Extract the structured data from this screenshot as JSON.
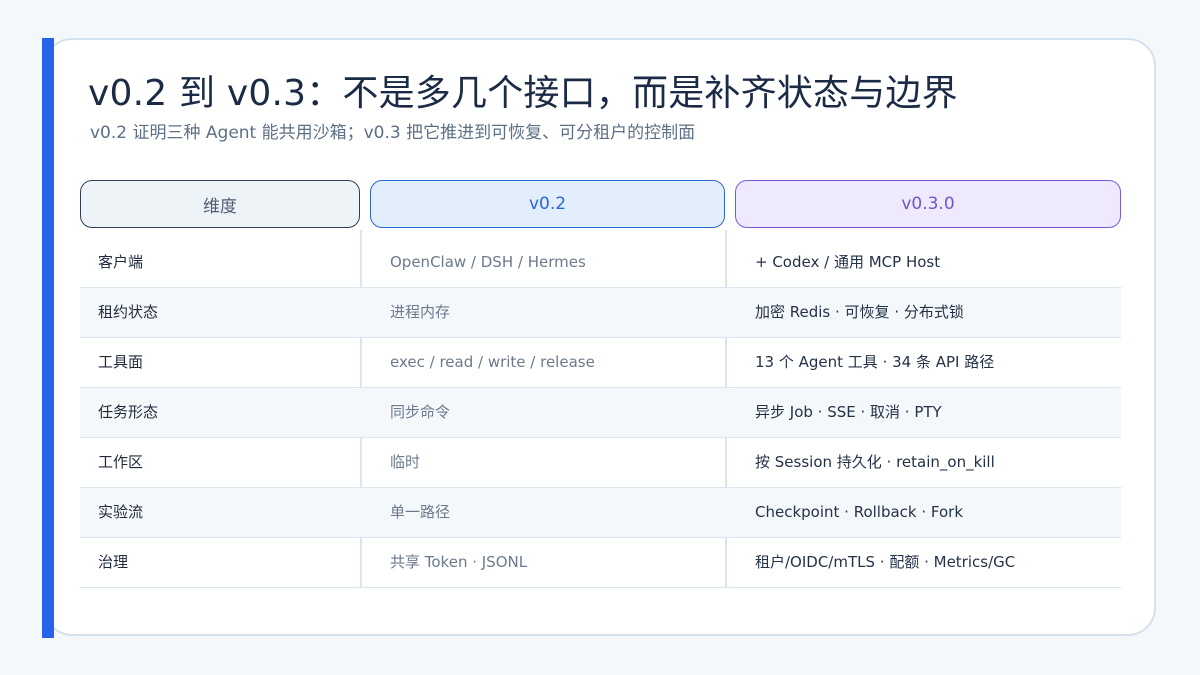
{
  "title": "v0.2 到 v0.3：不是多几个接口，而是补齐状态与边界",
  "subtitle": "v0.2 证明三种 Agent 能共用沙箱；v0.3 把它推进到可恢复、可分租户的控制面",
  "headers": {
    "dimension": "维度",
    "v02": "v0.2",
    "v03": "v0.3.0"
  },
  "rows": [
    {
      "dimension": "客户端",
      "v02": "OpenClaw / DSH / Hermes",
      "v03": "+ Codex / 通用 MCP Host"
    },
    {
      "dimension": "租约状态",
      "v02": "进程内存",
      "v03": "加密 Redis · 可恢复 · 分布式锁"
    },
    {
      "dimension": "工具面",
      "v02": "exec / read / write / release",
      "v03": "13 个 Agent 工具 · 34 条 API 路径"
    },
    {
      "dimension": "任务形态",
      "v02": "同步命令",
      "v03": "异步 Job · SSE · 取消 · PTY"
    },
    {
      "dimension": "工作区",
      "v02": "临时",
      "v03": "按 Session 持久化 · retain_on_kill"
    },
    {
      "dimension": "实验流",
      "v02": "单一路径",
      "v03": "Checkpoint · Rollback · Fork"
    },
    {
      "dimension": "治理",
      "v02": "共享 Token · JSONL",
      "v03": "租户/OIDC/mTLS · 配额 · Metrics/GC"
    }
  ],
  "colors": {
    "accent": "#2563eb",
    "v02": "#2a66d8",
    "v03": "#7553cc"
  }
}
